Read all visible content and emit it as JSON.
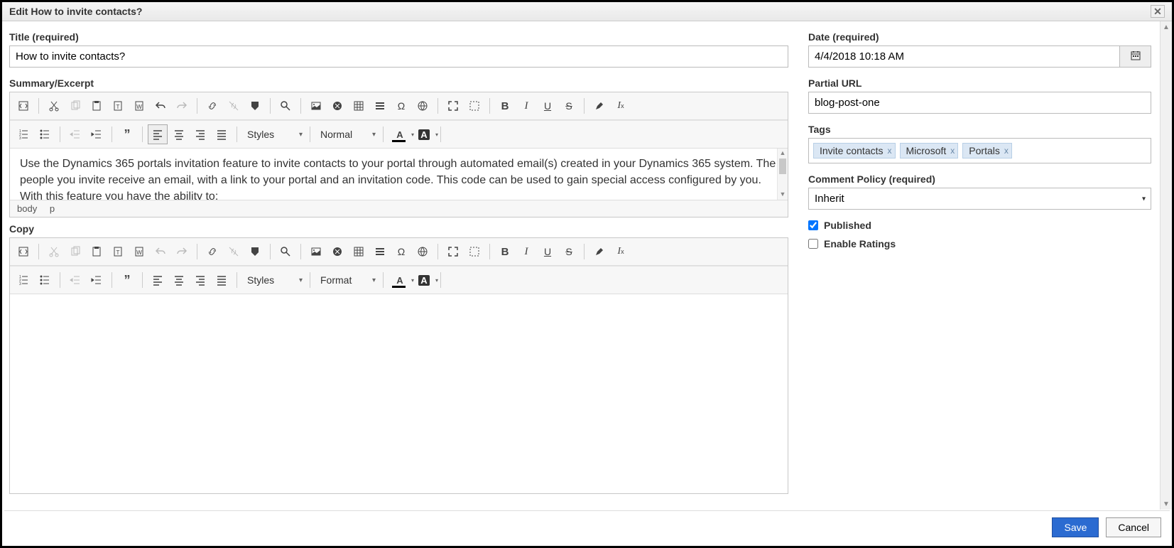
{
  "window": {
    "title": "Edit How to invite contacts?"
  },
  "left": {
    "title_label": "Title (required)",
    "title_value": "How to invite contacts?",
    "summary_label": "Summary/Excerpt",
    "summary_text": "Use the Dynamics 365 portals invitation feature to invite contacts to your portal through automated email(s) created in your Dynamics 365 system. The people you invite receive an email, with a link to your portal and an invitation code. This code can be used to gain special access configured by you. With this feature you have the ability to:",
    "copy_label": "Copy",
    "elpath": [
      "body",
      "p"
    ]
  },
  "toolbar": {
    "styles": "Styles",
    "normal": "Normal",
    "format": "Format"
  },
  "right": {
    "date_label": "Date (required)",
    "date_value": "4/4/2018 10:18 AM",
    "partial_url_label": "Partial URL",
    "partial_url_value": "blog-post-one",
    "tags_label": "Tags",
    "tags": [
      "Invite contacts",
      "Microsoft",
      "Portals"
    ],
    "comment_policy_label": "Comment Policy (required)",
    "comment_policy_value": "Inherit",
    "published_label": "Published",
    "published_checked": true,
    "enable_ratings_label": "Enable Ratings",
    "enable_ratings_checked": false
  },
  "footer": {
    "save": "Save",
    "cancel": "Cancel"
  }
}
